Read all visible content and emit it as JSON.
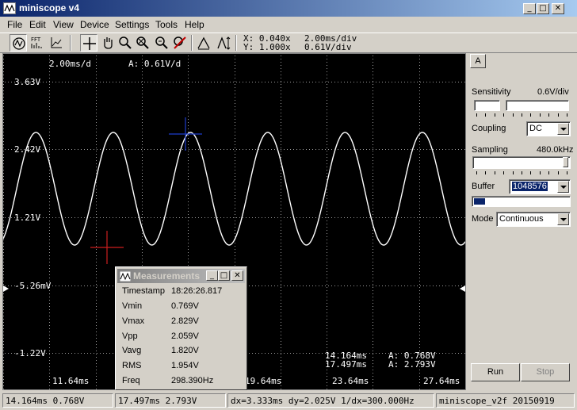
{
  "window": {
    "title": "miniscope v4",
    "minimize": "_",
    "maximize": "□",
    "close": "✕"
  },
  "menu": [
    "File",
    "Edit",
    "View",
    "Device",
    "Settings",
    "Tools",
    "Help"
  ],
  "toolbar": {
    "fft_label": "FFT",
    "coords": {
      "x": "X: 0.040x",
      "y": "Y: 1.000x"
    },
    "scale": {
      "time": "2.00ms/div",
      "volt": "0.61V/div"
    }
  },
  "scope": {
    "header_time": "2.00ms/d",
    "header_volt": "A: 0.61V/d",
    "y_labels": [
      "3.63V",
      "2.42V",
      "1.21V",
      "-5.26mV",
      "-1.22V"
    ],
    "x_labels": [
      "11.64ms",
      "19.64ms",
      "23.64ms",
      "27.64ms"
    ],
    "cursor_readout": [
      {
        "time": "14.164ms",
        "value": "A: 0.768V"
      },
      {
        "time": "17.497ms",
        "value": "A: 2.793V"
      }
    ],
    "trace_color": "#ffffff",
    "cursor_colors": {
      "blue": "#1e3ccc",
      "red": "#cc1e1e"
    }
  },
  "panel": {
    "channel_tab": "A",
    "sensitivity_label": "Sensitivity",
    "sensitivity_value": "0.6V/div",
    "coupling_label": "Coupling",
    "coupling_value": "DC",
    "sampling_label": "Sampling",
    "sampling_value": "480.0kHz",
    "buffer_label": "Buffer",
    "buffer_value": "1048576",
    "mode_label": "Mode",
    "mode_value": "Continuous",
    "run_label": "Run",
    "stop_label": "Stop"
  },
  "measurements": {
    "title": "Measurements",
    "rows": [
      {
        "label": "Timestamp",
        "value": "18:26:26.817"
      },
      {
        "label": "Vmin",
        "value": "0.769V"
      },
      {
        "label": "Vmax",
        "value": "2.829V"
      },
      {
        "label": "Vpp",
        "value": "2.059V"
      },
      {
        "label": "Vavg",
        "value": "1.820V"
      },
      {
        "label": "RMS",
        "value": "1.954V"
      },
      {
        "label": "Freq",
        "value": "298.390Hz"
      }
    ]
  },
  "status": [
    "14.164ms 0.768V",
    "17.497ms 2.793V",
    "dx=3.333ms dy=2.025V 1/dx=300.000Hz",
    "miniscope_v2f 20150919"
  ]
}
